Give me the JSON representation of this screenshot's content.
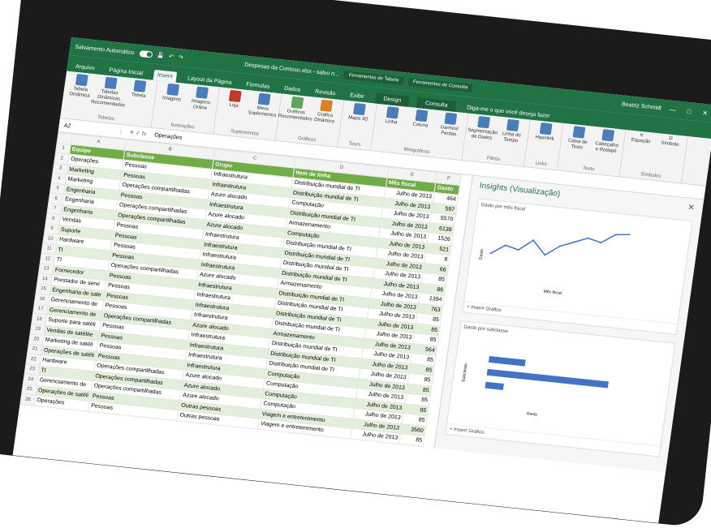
{
  "title_bar": {
    "autosave": "Salvamento Automático",
    "filename": "Despesas da Contoso.xlsx - salvo n...",
    "context_tab_1": "Ferramentas de Tabela",
    "context_tab_2": "Ferramentas de Consulta",
    "user": "Beatriz Schmidt"
  },
  "tabs": [
    "Arquivo",
    "Página Inicial",
    "Inserir",
    "Layout da Página",
    "Fórmulas",
    "Dados",
    "Revisão",
    "Exibir",
    "Design",
    "Consulta",
    "Diga-me o que você deseja fazer"
  ],
  "ribbon": {
    "groups": [
      {
        "label": "Tabelas",
        "items": [
          "Tabela Dinâmica",
          "Tabelas Dinâmicas Recomendadas",
          "Tabela"
        ]
      },
      {
        "label": "Ilustrações",
        "items": [
          "Imagens",
          "Imagens Online"
        ]
      },
      {
        "label": "Suplementos",
        "items": [
          "Loja",
          "Meus Suplementos"
        ]
      },
      {
        "label": "Gráficos",
        "items": [
          "Gráficos Recomendados",
          "Gráfico Dinâmico"
        ]
      },
      {
        "label": "Tours",
        "items": [
          "Mapa 3D"
        ]
      },
      {
        "label": "Minigráficos",
        "items": [
          "Linha",
          "Coluna",
          "Ganhos/ Perdas"
        ]
      },
      {
        "label": "Filtros",
        "items": [
          "Segmentação de Dados",
          "Linha do Tempo"
        ]
      },
      {
        "label": "Links",
        "items": [
          "Hiperlink"
        ]
      },
      {
        "label": "Texto",
        "items": [
          "Caixa de Texto",
          "Cabeçalho e Rodapé"
        ]
      },
      {
        "label": "Símbolos",
        "items": [
          "Equação",
          "Símbolo"
        ]
      }
    ]
  },
  "formula_bar": {
    "cell": "A2",
    "value": "Operações"
  },
  "columns": [
    "A",
    "B",
    "C",
    "D",
    "E",
    "F"
  ],
  "headers": [
    "Equipe",
    "Subclasse",
    "Grupo",
    "Item de linha",
    "Mês fiscal",
    "Gasto"
  ],
  "rows": [
    [
      "Operações",
      "Pessoas",
      "Infraestrutura",
      "Distribuição mundial de TI",
      "Julho de 2013",
      "464"
    ],
    [
      "Marketing",
      "Pessoas",
      "Infraestrutura",
      "Distribuição mundial de TI",
      "Julho de 2013",
      "597"
    ],
    [
      "Marketing",
      "Operações compartilhadas",
      "Azure alocado",
      "Computação",
      "Julho de 2013",
      "5570"
    ],
    [
      "Engenharia",
      "Pessoas",
      "Infraestrutura",
      "Distribuição mundial de TI",
      "Julho de 2013",
      "6138"
    ],
    [
      "Engenharia",
      "Operações compartilhadas",
      "Azure alocado",
      "Armazenamento",
      "Julho de 2013",
      "1526"
    ],
    [
      "Engenharia",
      "Operações compartilhadas",
      "Azure alocado",
      "Computação",
      "Julho de 2013",
      "521"
    ],
    [
      "Vendas",
      "Pessoas",
      "Infraestrutura",
      "Distribuição mundial de TI",
      "Julho de 2013",
      "8"
    ],
    [
      "Suporte",
      "Pessoas",
      "Infraestrutura",
      "Distribuição mundial de TI",
      "Julho de 2013",
      "66"
    ],
    [
      "Hardware",
      "Pessoas",
      "Infraestrutura",
      "Distribuição mundial de TI",
      "Julho de 2013",
      "85"
    ],
    [
      "TI",
      "Pessoas",
      "Infraestrutura",
      "Distribuição mundial de TI",
      "Julho de 2013",
      "86"
    ],
    [
      "TI",
      "Operações compartilhadas",
      "Azure alocado",
      "Armazenamento",
      "Julho de 2013",
      "1394"
    ],
    [
      "Fornecedor",
      "Pessoas",
      "Infraestrutura",
      "Distribuição mundial de TI",
      "Julho de 2013",
      "763"
    ],
    [
      "Prestador de servi",
      "Pessoas",
      "Infraestrutura",
      "Distribuição mundial de TI",
      "Julho de 2013",
      "85"
    ],
    [
      "Engenharia de sate",
      "Pessoas",
      "Infraestrutura",
      "Distribuição mundial de TI",
      "Julho de 2013",
      "85"
    ],
    [
      "Gerenciamento de",
      "Pessoas",
      "Infraestrutura",
      "Distribuição mundial de TI",
      "Julho de 2013",
      "85"
    ],
    [
      "Gerenciamento de",
      "Operações compartilhadas",
      "Azure alocado",
      "Armazenamento",
      "Julho de 2013",
      "564"
    ],
    [
      "Suporte para satéli",
      "Pessoas",
      "Infraestrutura",
      "Distribuição mundial de TI",
      "Julho de 2013",
      "85"
    ],
    [
      "Vendas de satélite",
      "Pessoas",
      "Infraestrutura",
      "Distribuição mundial de TI",
      "Julho de 2013",
      "85"
    ],
    [
      "Marketing de satéli",
      "Pessoas",
      "Infraestrutura",
      "Distribuição mundial de TI",
      "Julho de 2013",
      "85"
    ],
    [
      "Operações de satéli",
      "Pessoas",
      "Infraestrutura",
      "Computação",
      "Julho de 2013",
      "85"
    ],
    [
      "Hardware",
      "Operações compartilhadas",
      "Azure alocado",
      "Computação",
      "Julho de 2013",
      "85"
    ],
    [
      "TI",
      "Operações compartilhadas",
      "Azure alocado",
      "Computação",
      "Julho de 2013",
      "85"
    ],
    [
      "Gerenciamento de",
      "Operações compartilhadas",
      "Azure alocado",
      "Computação",
      "Julho de 2013",
      "85"
    ],
    [
      "Operações de satéli",
      "Pessoas",
      "Outras pessoas",
      "Viagem e entretenimento",
      "Julho de 2013",
      "3560"
    ],
    [
      "Operações",
      "Pessoas",
      "Outras pessoas",
      "Viagem e entretenimento",
      "Julho de 2013",
      "85"
    ]
  ],
  "pane": {
    "title": "Insights (Visualização)",
    "card1_title": "Gasto por mês fiscal",
    "card1_xlabel": "Mês fiscal",
    "card1_ylabel": "Gasto",
    "card2_title": "Gasto por subclasse",
    "card2_xlabel": "Gasto",
    "card2_ylabel": "Subclasse",
    "insert_chart": "Inserir Gráfico"
  },
  "chart_data": [
    {
      "type": "line",
      "title": "Gasto por mês fiscal",
      "xlabel": "Mês fiscal",
      "ylabel": "Gasto",
      "values": [
        30,
        42,
        38,
        52,
        35,
        48,
        55,
        62,
        58,
        70,
        72
      ]
    },
    {
      "type": "bar",
      "title": "Gasto por subclasse",
      "xlabel": "Gasto",
      "ylabel": "Subclasse",
      "values": [
        30,
        100,
        15
      ]
    }
  ]
}
